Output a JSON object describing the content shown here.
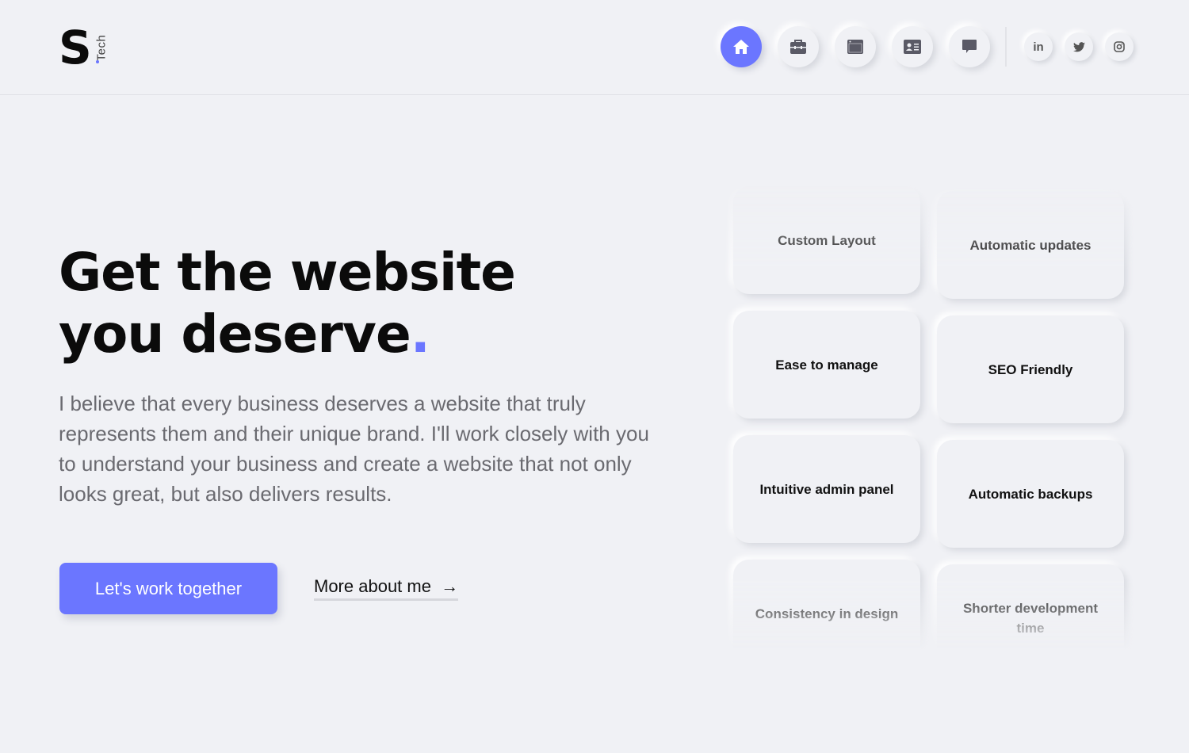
{
  "logo": {
    "letter": "S",
    "suffix": "Tech"
  },
  "nav": {
    "items": [
      {
        "name": "home",
        "icon": "home-icon",
        "active": true
      },
      {
        "name": "services",
        "icon": "briefcase-icon"
      },
      {
        "name": "portfolio",
        "icon": "browser-window-icon"
      },
      {
        "name": "about",
        "icon": "id-card-icon"
      },
      {
        "name": "contact",
        "icon": "chat-bubble-icon"
      }
    ],
    "social": [
      {
        "name": "linkedin",
        "label": "in"
      },
      {
        "name": "twitter",
        "icon": "twitter-icon"
      },
      {
        "name": "instagram",
        "icon": "instagram-icon"
      }
    ]
  },
  "hero": {
    "title_line1": "Get the website",
    "title_line2": "you deserve",
    "title_dot": ".",
    "description": "I believe that every business deserves a website that truly represents them and their unique brand. I'll work closely with you to understand your business and create a website that not only looks great, but also delivers results.",
    "cta": "Let's work together",
    "more": "More about me",
    "more_arrow": "→"
  },
  "features": [
    "Custom Layout",
    "Automatic updates",
    "Ease to manage",
    "SEO Friendly",
    "Intuitive admin panel",
    "Automatic backups",
    "Consistency in design",
    "Shorter development time"
  ],
  "colors": {
    "accent": "#6b76ff",
    "background": "#f0f1f5"
  }
}
